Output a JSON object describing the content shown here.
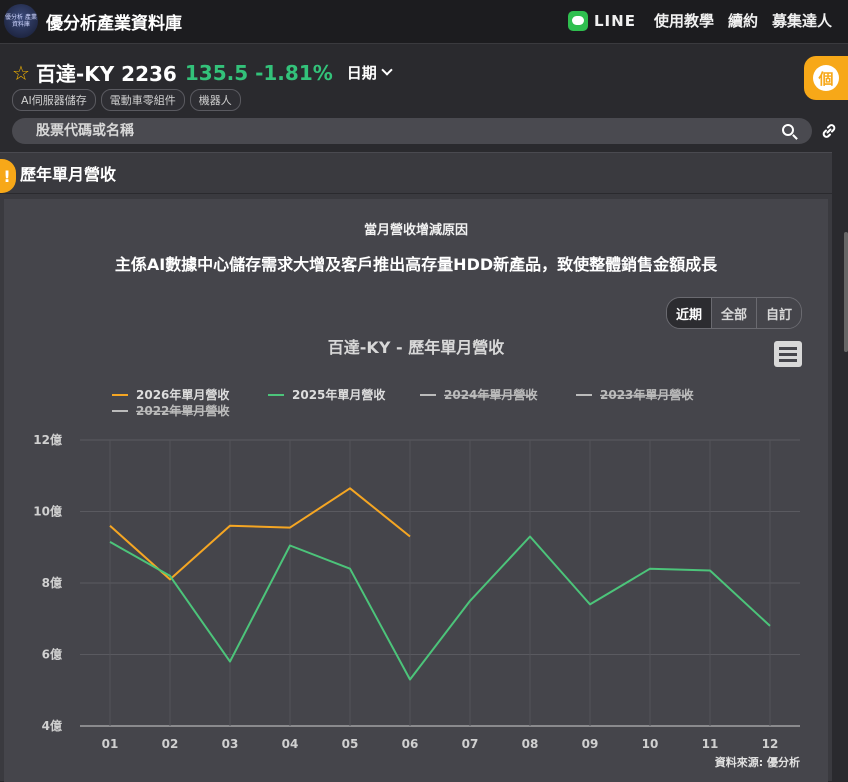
{
  "app": {
    "title": "優分析產業資料庫",
    "logo_text": "優分析 產業資料庫"
  },
  "nav": {
    "line_label": "LINE",
    "tutorial": "使用教學",
    "subscribe": "續約",
    "recruit": "募集達人"
  },
  "stock": {
    "name": "百達-KY 2236",
    "price_change": "135.5 -1.81%",
    "date_label": "日期",
    "tags": [
      "AI伺服器儲存",
      "電動車零組件",
      "機器人"
    ]
  },
  "side_badge": "個",
  "search": {
    "placeholder": "股票代碼或名稱"
  },
  "section": {
    "title": "歷年單月營收",
    "bulb_glyph": "!"
  },
  "reason": {
    "title": "當月營收增減原因",
    "text": "主係AI數據中心儲存需求大增及客戶推出高存量HDD新產品，致使整體銷售金額成長"
  },
  "range_buttons": [
    "近期",
    "全部",
    "自訂"
  ],
  "colors": {
    "series_2026": "#f5a623",
    "series_2025": "#4cc47a",
    "series_hidden": "#cccccc",
    "accent": "#f7a818"
  },
  "chart_data": {
    "type": "line",
    "title": "百達-KY - 歷年單月營收",
    "categories": [
      "01",
      "02",
      "03",
      "04",
      "05",
      "06",
      "07",
      "08",
      "09",
      "10",
      "11",
      "12"
    ],
    "y_ticks": [
      "4億",
      "6億",
      "8億",
      "10億",
      "12億"
    ],
    "ylim": [
      4,
      12
    ],
    "series": [
      {
        "name": "2026年單月營收",
        "visible": true,
        "values": [
          9.6,
          8.1,
          9.6,
          9.55,
          10.65,
          9.3
        ]
      },
      {
        "name": "2025年單月營收",
        "visible": true,
        "values": [
          9.15,
          8.2,
          5.8,
          9.05,
          8.4,
          5.3,
          7.5,
          9.3,
          7.4,
          8.4,
          8.35,
          6.8
        ]
      },
      {
        "name": "2024年單月營收",
        "visible": false,
        "values": []
      },
      {
        "name": "2023年單月營收",
        "visible": false,
        "values": []
      },
      {
        "name": "2022年單月營收",
        "visible": false,
        "values": []
      }
    ],
    "source": "資料來源: 優分析",
    "grid": true,
    "legend_position": "top-left"
  }
}
